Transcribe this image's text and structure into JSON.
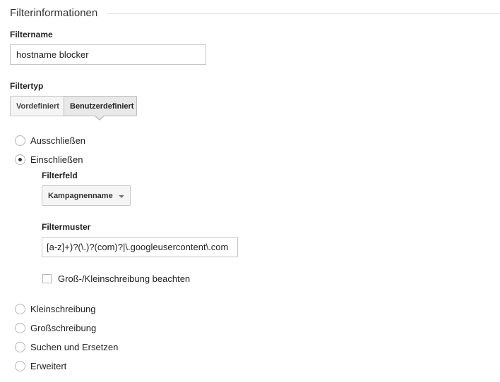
{
  "section": {
    "title": "Filterinformationen"
  },
  "filter_name": {
    "label": "Filtername",
    "value": "hostname blocker"
  },
  "filter_type": {
    "label": "Filtertyp",
    "tabs": [
      {
        "label": "Vordefiniert",
        "selected": false
      },
      {
        "label": "Benutzerdefiniert",
        "selected": true
      }
    ]
  },
  "options": {
    "exclude": {
      "label": "Ausschließen",
      "checked": false
    },
    "include": {
      "label": "Einschließen",
      "checked": true
    },
    "lowercase": {
      "label": "Kleinschreibung",
      "checked": false
    },
    "uppercase": {
      "label": "Großschreibung",
      "checked": false
    },
    "search_replace": {
      "label": "Suchen und Ersetzen",
      "checked": false
    },
    "advanced": {
      "label": "Erweitert",
      "checked": false
    }
  },
  "include_settings": {
    "field_label": "Filterfeld",
    "field_value": "Kampagnenname",
    "pattern_label": "Filtermuster",
    "pattern_value": "[a-z]+)?(\\.)?(com)?|\\.googleusercontent\\.com",
    "case_sensitive_label": "Groß-/Kleinschreibung beachten",
    "case_sensitive_checked": false
  },
  "icons": {
    "dropdown": "caret-down-icon"
  }
}
